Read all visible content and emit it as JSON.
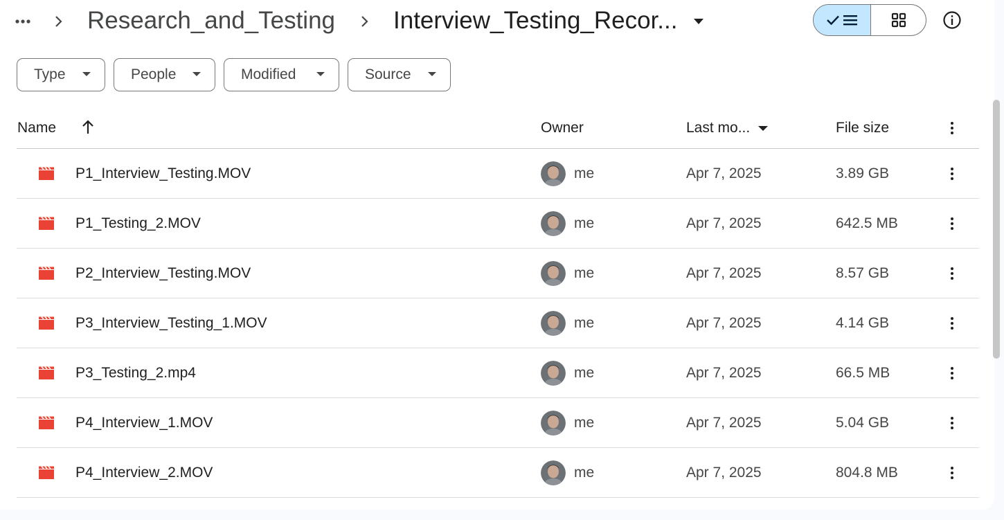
{
  "breadcrumb": {
    "parent": "Research_and_Testing",
    "current": "Interview_Testing_Recor..."
  },
  "filters": [
    {
      "label": "Type"
    },
    {
      "label": "People"
    },
    {
      "label": "Modified"
    },
    {
      "label": "Source"
    }
  ],
  "columns": {
    "name": "Name",
    "owner": "Owner",
    "modified": "Last mo...",
    "size": "File size"
  },
  "files": [
    {
      "name": "P1_Interview_Testing.MOV",
      "owner": "me",
      "modified": "Apr 7, 2025",
      "size": "3.89 GB"
    },
    {
      "name": "P1_Testing_2.MOV",
      "owner": "me",
      "modified": "Apr 7, 2025",
      "size": "642.5 MB"
    },
    {
      "name": "P2_Interview_Testing.MOV",
      "owner": "me",
      "modified": "Apr 7, 2025",
      "size": "8.57 GB"
    },
    {
      "name": "P3_Interview_Testing_1.MOV",
      "owner": "me",
      "modified": "Apr 7, 2025",
      "size": "4.14 GB"
    },
    {
      "name": "P3_Testing_2.mp4",
      "owner": "me",
      "modified": "Apr 7, 2025",
      "size": "66.5 MB"
    },
    {
      "name": "P4_Interview_1.MOV",
      "owner": "me",
      "modified": "Apr 7, 2025",
      "size": "5.04 GB"
    },
    {
      "name": "P4_Interview_2.MOV",
      "owner": "me",
      "modified": "Apr 7, 2025",
      "size": "804.8 MB"
    }
  ],
  "icons": {
    "file": "video-file-icon",
    "view_list": "list-view-icon",
    "view_grid": "grid-view-icon",
    "info": "info-icon"
  },
  "colors": {
    "video_icon": "#ea4335",
    "view_selected_bg": "#c2e7ff"
  }
}
